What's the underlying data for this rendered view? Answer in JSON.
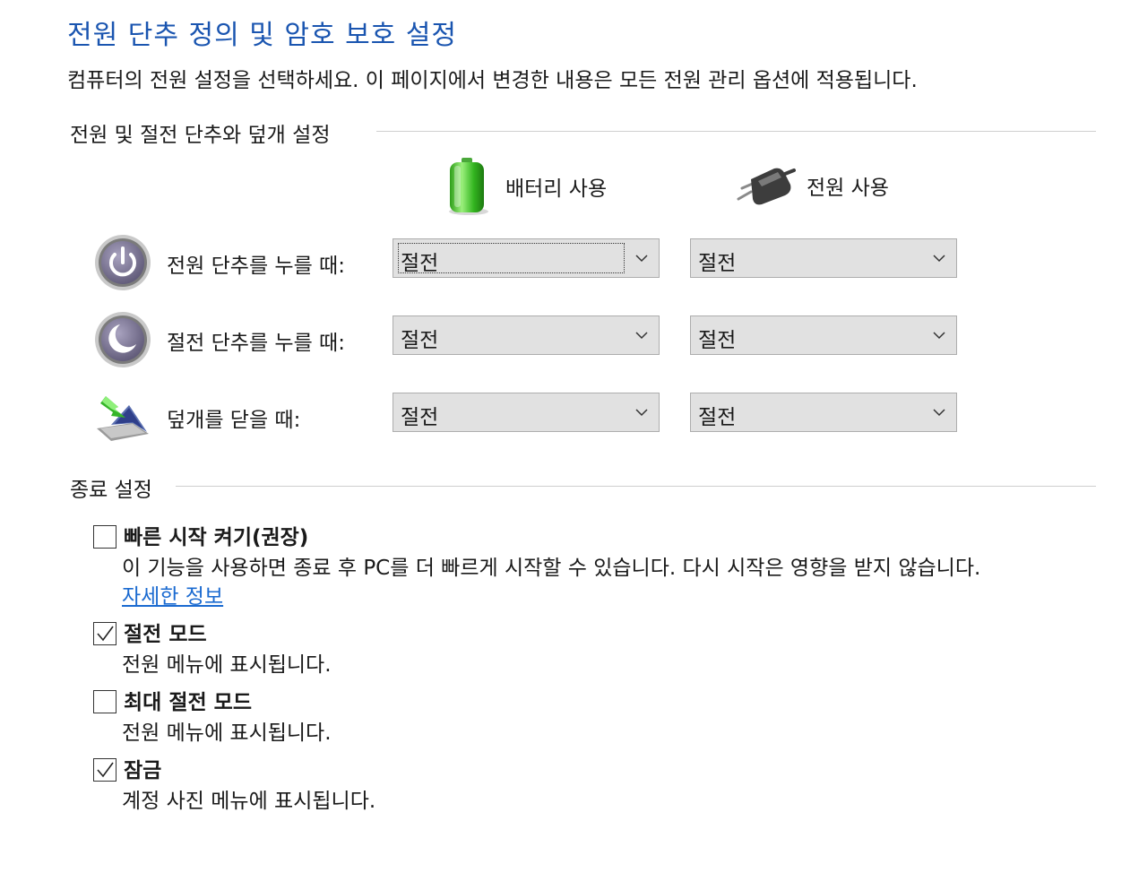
{
  "header": {
    "title": "전원 단추 정의 및 암호 보호 설정",
    "description": "컴퓨터의 전원 설정을 선택하세요. 이 페이지에서 변경한 내용은 모든 전원 관리 옵션에 적용됩니다."
  },
  "power_section": {
    "heading": "전원 및 절전 단추와 덮개 설정",
    "columns": {
      "battery": "배터리 사용",
      "plugged": "전원 사용"
    },
    "rows": [
      {
        "label": "전원 단추를 누를 때:",
        "icon": "power-button-icon",
        "battery_value": "절전",
        "plugged_value": "절전"
      },
      {
        "label": "절전 단추를 누를 때:",
        "icon": "sleep-button-icon",
        "battery_value": "절전",
        "plugged_value": "절전"
      },
      {
        "label": "덮개를 닫을 때:",
        "icon": "lid-close-icon",
        "battery_value": "절전",
        "plugged_value": "절전"
      }
    ]
  },
  "shutdown_section": {
    "heading": "종료 설정",
    "items": [
      {
        "title": "빠른 시작 켜기(권장)",
        "description": "이 기능을 사용하면 종료 후 PC를 더 빠르게 시작할 수 있습니다. 다시 시작은 영향을 받지 않습니다.",
        "link": "자세한 정보",
        "checked": false
      },
      {
        "title": "절전 모드",
        "description": "전원 메뉴에 표시됩니다.",
        "checked": true
      },
      {
        "title": "최대 절전 모드",
        "description": "전원 메뉴에 표시됩니다.",
        "checked": false
      },
      {
        "title": "잠금",
        "description": "계정 사진 메뉴에 표시됩니다.",
        "checked": true
      }
    ]
  },
  "colors": {
    "title": "#1a55b0",
    "link": "#1a6ad0",
    "select_bg": "#e1e1e1"
  }
}
